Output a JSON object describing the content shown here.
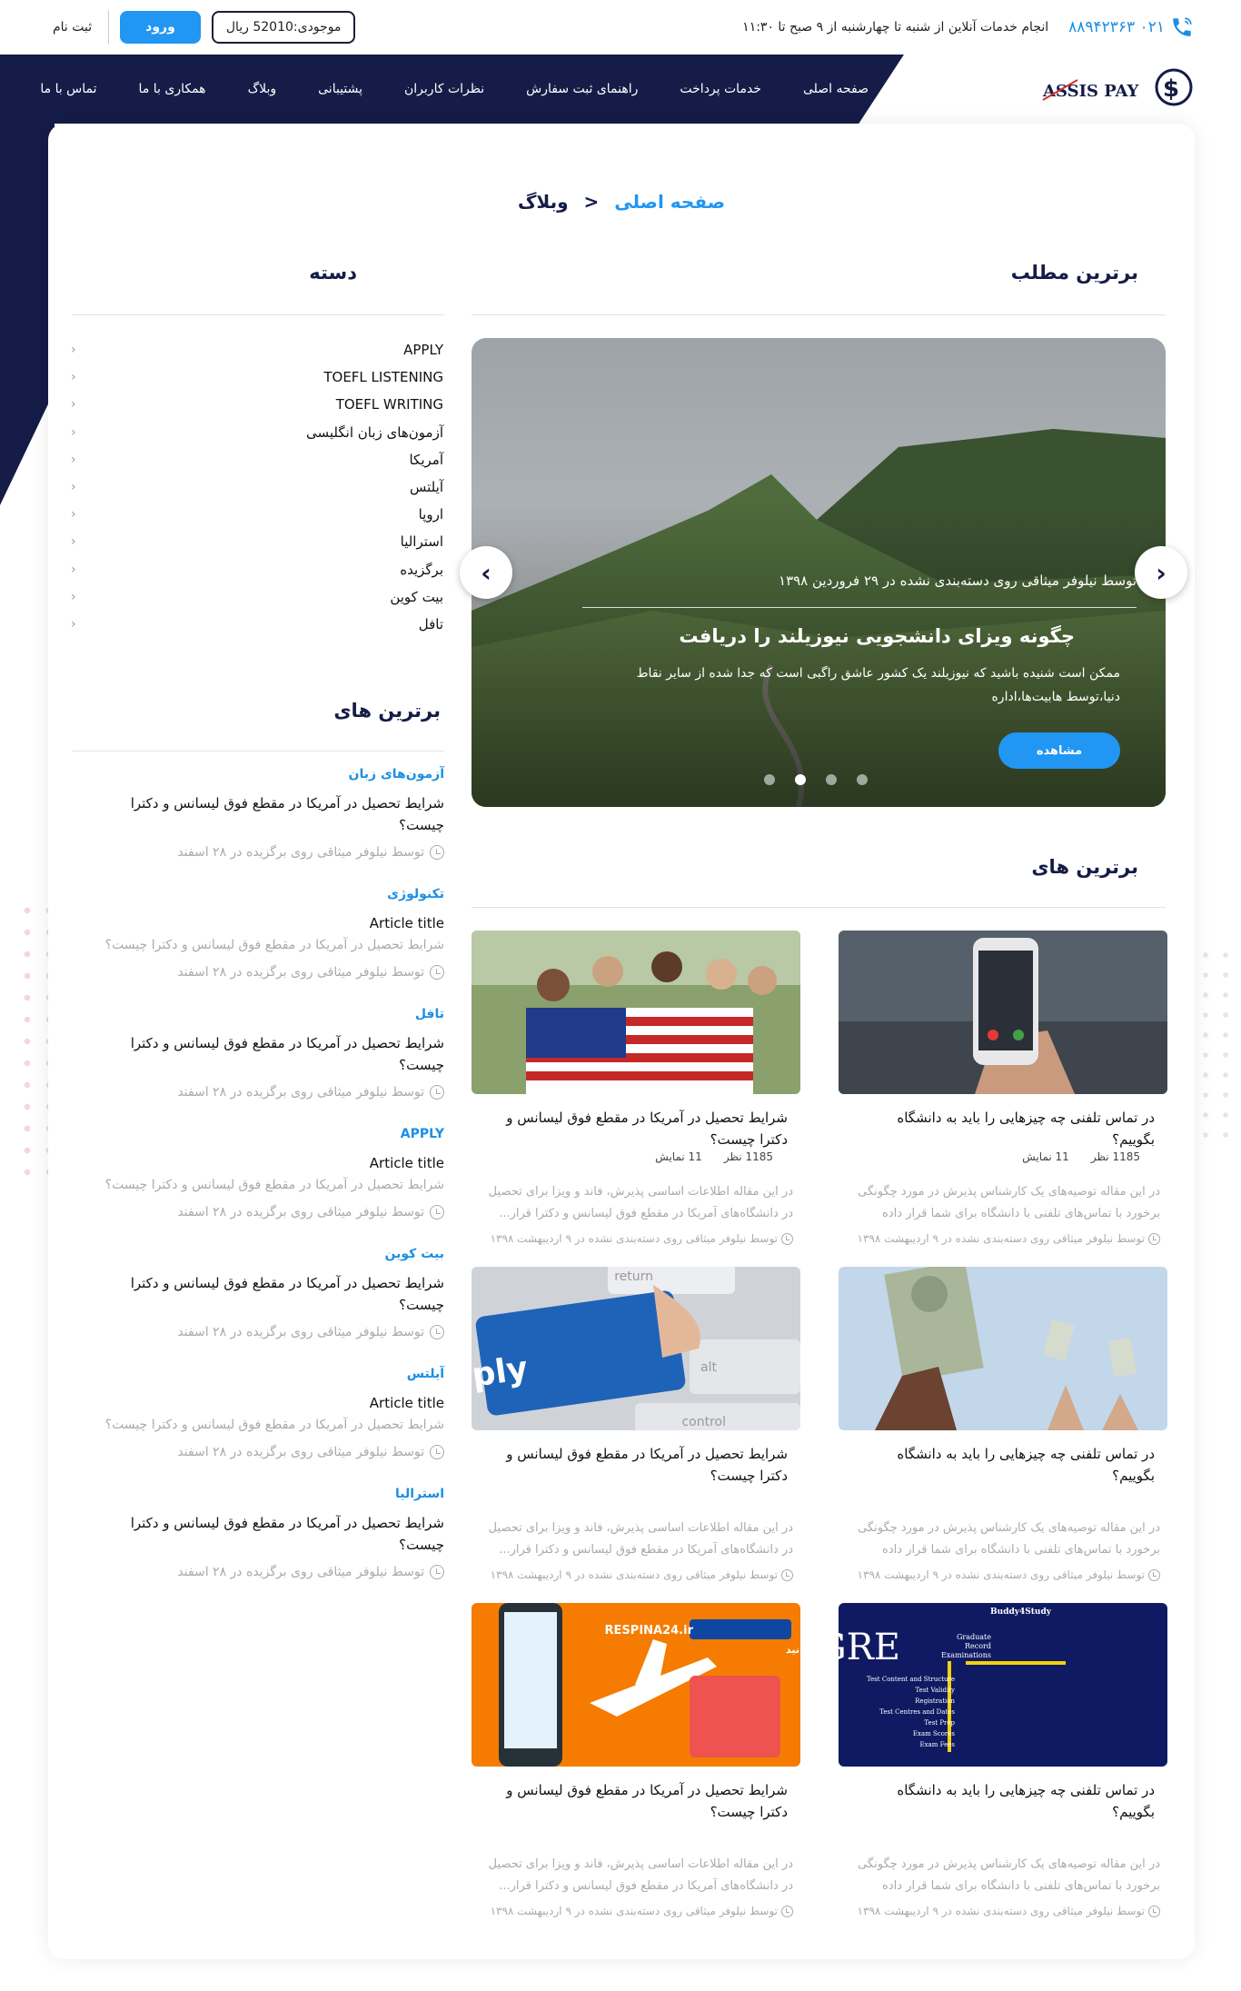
{
  "topbar": {
    "phone": "۰۲۱ ۸۸۹۴۲۳۶۳",
    "hours": "انجام خدمات آنلاین از شنبه تا چهارشنبه از ۹ صبح تا ۱۱:۳۰",
    "wallet": "موجودی:52010 ریال",
    "login": "ورود",
    "signup": "ثبت نام"
  },
  "nav": {
    "logo_text": "ASSIS PAY",
    "items": [
      "صفحه اصلی",
      "خدمات پرداخت",
      "راهنمای ثبت سفارش",
      "نظرات کاربران",
      "پشتیبانی",
      "وبلاگ",
      "همکاری با ما",
      "تماس با ما"
    ]
  },
  "breadcrumb": {
    "home": "صفحه اصلی",
    "separator": "<",
    "current": "وبلاگ"
  },
  "featured": {
    "heading": "برترین مطلب",
    "meta": "توسط نیلوفر میثاقی روی دسته‌بندی نشده در ۲۹ فروردین ۱۳۹۸",
    "title": "چگونه ویزای دانشجویی نیوزیلند را دریافت",
    "excerpt": "ممکن است شنیده باشید که نیوزیلند یک کشور عاشق راگبی است که جدا شده از سایر نقاط دنیا،توسط هابیت‌ها،اداره",
    "button": "مشاهده",
    "dots": 4,
    "active_dot": 1
  },
  "categories": {
    "heading": "دسته",
    "items": [
      "APPLY",
      "TOEFL LISTENING",
      "TOEFL WRITING",
      "آزمون‌های زبان انگلیسی",
      "آمریکا",
      "آیلتس",
      "اروپا",
      "استرالیا",
      "برگزیده",
      "بیت کوین",
      "تافل"
    ]
  },
  "side_top": {
    "heading": "برترین های",
    "items": [
      {
        "category": "آزمون‌های زبان",
        "title": "شرایط تحصیل در آمریکا در مقطع فوق لیسانس و دکترا چیست؟",
        "excerpt": "",
        "meta": "توسط نیلوفر میثاقی روی برگزیده در ۲۸ اسفند"
      },
      {
        "category": "تکنولوژی",
        "title": "Article title",
        "excerpt": "شرایط تحصیل در آمریکا در مقطع فوق لیسانس و دکترا چیست؟",
        "meta": "توسط نیلوفر میثاقی روی برگزیده در ۲۸ اسفند"
      },
      {
        "category": "تافل",
        "title": "شرایط تحصیل در آمریکا در مقطع فوق لیسانس و دکترا چیست؟",
        "excerpt": "",
        "meta": "توسط نیلوفر میثاقی روی برگزیده در ۲۸ اسفند"
      },
      {
        "category": "APPLY",
        "title": "Article title",
        "excerpt": "شرایط تحصیل در آمریکا در مقطع فوق لیسانس و دکترا چیست؟",
        "meta": "توسط نیلوفر میثاقی روی برگزیده در ۲۸ اسفند"
      },
      {
        "category": "بیت کوین",
        "title": "شرایط تحصیل در آمریکا در مقطع فوق لیسانس و دکترا چیست؟",
        "excerpt": "",
        "meta": "توسط نیلوفر میثاقی روی برگزیده در ۲۸ اسفند"
      },
      {
        "category": "آیلتس",
        "title": "Article title",
        "excerpt": "شرایط تحصیل در آمریکا در مقطع فوق لیسانس و دکترا چیست؟",
        "meta": "توسط نیلوفر میثاقی روی برگزیده در ۲۸ اسفند"
      },
      {
        "category": "استرالیا",
        "title": "شرایط تحصیل در آمریکا در مقطع فوق لیسانس و دکترا چیست؟",
        "excerpt": "",
        "meta": "توسط نیلوفر میثاقی روی برگزیده در ۲۸ اسفند"
      }
    ]
  },
  "main_top": {
    "heading": "برترین های",
    "cards": [
      {
        "image": "phone-call-photo",
        "title": "در تماس تلفنی چه چیزهایی را باید به دانشگاه بگوییم؟",
        "comments": "1185 نظر",
        "views": "11 نمایش",
        "excerpt": "در این مقاله توصیه‌های یک کارشناس پذیرش در مورد چگونگی برخورد با تماس‌های تلفنی با دانشگاه برای شما قرار داده",
        "meta": "توسط نیلوفر میثاقی روی دسته‌بندی نشده در ۹ اردیبهشت ۱۳۹۸"
      },
      {
        "image": "students-flag-photo",
        "title": "شرایط تحصیل در آمریکا در مقطع فوق لیسانس و دکترا چیست؟",
        "comments": "1185 نظر",
        "views": "11 نمایش",
        "excerpt": "در این مقاله اطلاعات اساسی پذیرش، فاند و ویزا برای تحصیل در دانشگاه‌های آمریکا در مقطع فوق لیسانس و دکترا قرار...",
        "meta": "توسط نیلوفر میثاقی روی دسته‌بندی نشده در ۹ اردیبهشت ۱۳۹۸"
      },
      {
        "image": "dollar-hands-photo",
        "title": "در تماس تلفنی چه چیزهایی را باید به دانشگاه بگوییم؟",
        "comments": "",
        "views": "",
        "excerpt": "در این مقاله توصیه‌های یک کارشناس پذیرش در مورد چگونگی برخورد با تماس‌های تلفنی با دانشگاه برای شما قرار داده",
        "meta": "توسط نیلوفر میثاقی روی دسته‌بندی نشده در ۹ اردیبهشت ۱۳۹۸"
      },
      {
        "image": "apply-key-photo",
        "title": "شرایط تحصیل در آمریکا در مقطع فوق لیسانس و دکترا چیست؟",
        "comments": "",
        "views": "",
        "excerpt": "در این مقاله اطلاعات اساسی پذیرش، فاند و ویزا برای تحصیل در دانشگاه‌های آمریکا در مقطع فوق لیسانس و دکترا قرار...",
        "meta": "توسط نیلوفر میثاقی روی دسته‌بندی نشده در ۹ اردیبهشت ۱۳۹۸"
      },
      {
        "image": "gre-photo",
        "title": "در تماس تلفنی چه چیزهایی را باید به دانشگاه بگوییم؟",
        "comments": "",
        "views": "",
        "excerpt": "در این مقاله توصیه‌های یک کارشناس پذیرش در مورد چگونگی برخورد با تماس‌های تلفنی با دانشگاه برای شما قرار داده",
        "meta": "توسط نیلوفر میثاقی روی دسته‌بندی نشده در ۹ اردیبهشت ۱۳۹۸"
      },
      {
        "image": "respina-ad-photo",
        "title": "شرایط تحصیل در آمریکا در مقطع فوق لیسانس و دکترا چیست؟",
        "comments": "",
        "views": "",
        "excerpt": "در این مقاله اطلاعات اساسی پذیرش، فاند و ویزا برای تحصیل در دانشگاه‌های آمریکا در مقطع فوق لیسانس و دکترا قرار...",
        "meta": "توسط نیلوفر میثاقی روی دسته‌بندی نشده در ۹ اردیبهشت ۱۳۹۸"
      }
    ]
  },
  "gre_image": {
    "brand": "Buddy4Study",
    "title": "GRE",
    "subtitle": [
      "Graduate",
      "Record",
      "Examinations"
    ],
    "list": [
      "Test Content and Structure",
      "Test Validity",
      "Registration",
      "Test Centres and Dates",
      "Test Prep",
      "Exam Scores",
      "Exam Fees"
    ]
  },
  "respina_image": {
    "brand": "RESPINA24.ir",
    "tagline": "روی زمین نمی‌مانید"
  },
  "apply_image": {
    "key_label": "Apply",
    "key_above": "return",
    "key_right": "alt",
    "key_bottom": "control"
  }
}
